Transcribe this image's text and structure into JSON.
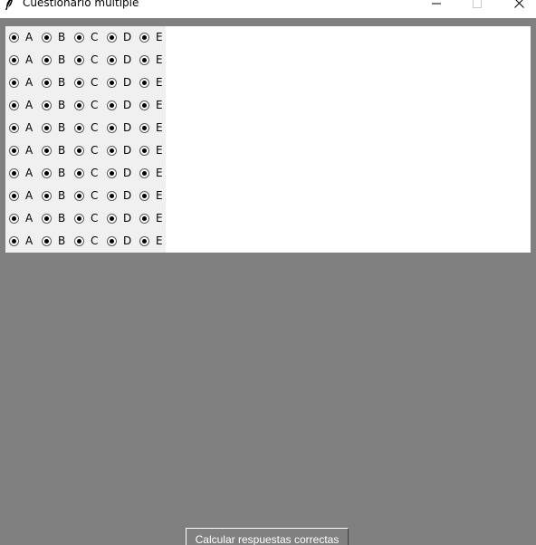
{
  "window": {
    "title": "Cuestionario multiple",
    "icon": "feather-icon",
    "controls": [
      "minimize-icon",
      "maximize-icon",
      "close-icon"
    ]
  },
  "quiz": {
    "options": [
      "A",
      "B",
      "C",
      "D",
      "E"
    ],
    "questions": [
      {
        "options": [
          "A",
          "B",
          "C",
          "D",
          "E"
        ]
      },
      {
        "options": [
          "A",
          "B",
          "C",
          "D",
          "E"
        ]
      },
      {
        "options": [
          "A",
          "B",
          "C",
          "D",
          "E"
        ]
      },
      {
        "options": [
          "A",
          "B",
          "C",
          "D",
          "E"
        ]
      },
      {
        "options": [
          "A",
          "B",
          "C",
          "D",
          "E"
        ]
      },
      {
        "options": [
          "A",
          "B",
          "C",
          "D",
          "E"
        ]
      },
      {
        "options": [
          "A",
          "B",
          "C",
          "D",
          "E"
        ]
      },
      {
        "options": [
          "A",
          "B",
          "C",
          "D",
          "E"
        ]
      },
      {
        "options": [
          "A",
          "B",
          "C",
          "D",
          "E"
        ]
      },
      {
        "options": [
          "A",
          "B",
          "C",
          "D",
          "E"
        ]
      }
    ]
  },
  "actions": {
    "calculate_label": "Calcular respuestas correctas"
  },
  "colors": {
    "window_background": "#808080",
    "quiz_panel": "#ffffff",
    "radio_area": "#f0f0f0",
    "button_text": "#ffffff"
  }
}
